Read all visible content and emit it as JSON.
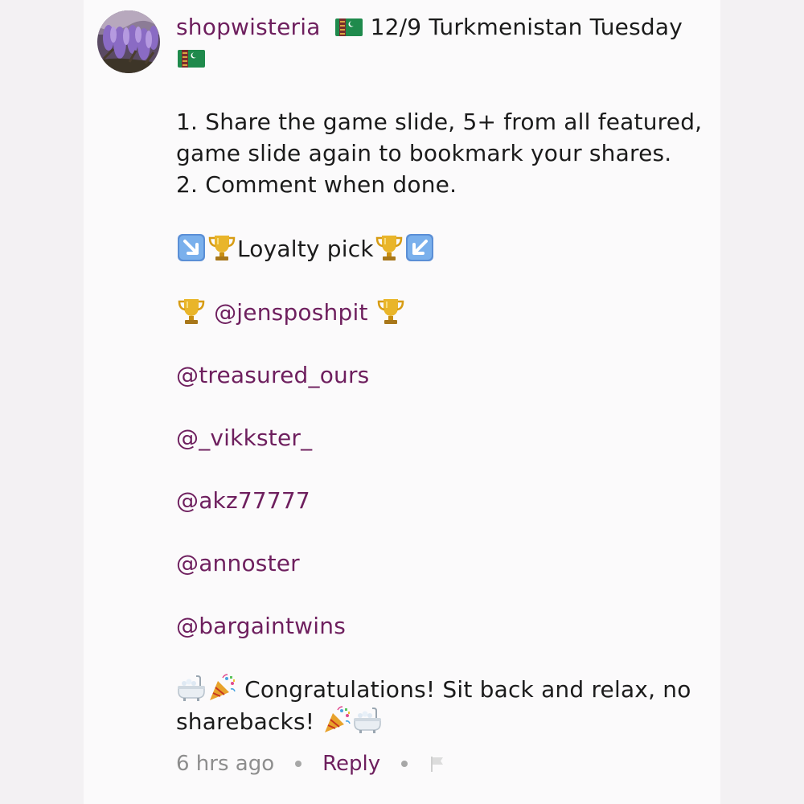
{
  "comment": {
    "username": "shopwisteria",
    "title_text": "12/9 Turkmenistan Tuesday",
    "instructions": [
      "1. Share the game slide, 5+ from all featured,",
      "game slide again to bookmark your shares.",
      "2. Comment when done."
    ],
    "loyalty_label": "Loyalty pick",
    "loyalty_mention": "@jensposhpit",
    "featured_mentions": [
      "@treasured_ours",
      "@_vikkster_",
      "@akz77777",
      "@annoster",
      "@bargaintwins"
    ],
    "congrats_line1": "Congratulations! Sit back and relax, no",
    "congrats_line2": "sharebacks!",
    "timestamp": "6 hrs ago",
    "reply_label": "Reply"
  },
  "icons": {
    "flag": "turkmenistan-flag-icon",
    "trophy": "trophy-icon",
    "arrow_down_right": "arrow-down-right-icon",
    "arrow_down_left": "arrow-down-left-icon",
    "bathtub": "bathtub-icon",
    "party_popper": "party-popper-icon",
    "report_flag": "report-flag-icon"
  },
  "colors": {
    "accent": "#6e1f5e",
    "text": "#1b1b1b",
    "muted": "#8d8d8d"
  }
}
